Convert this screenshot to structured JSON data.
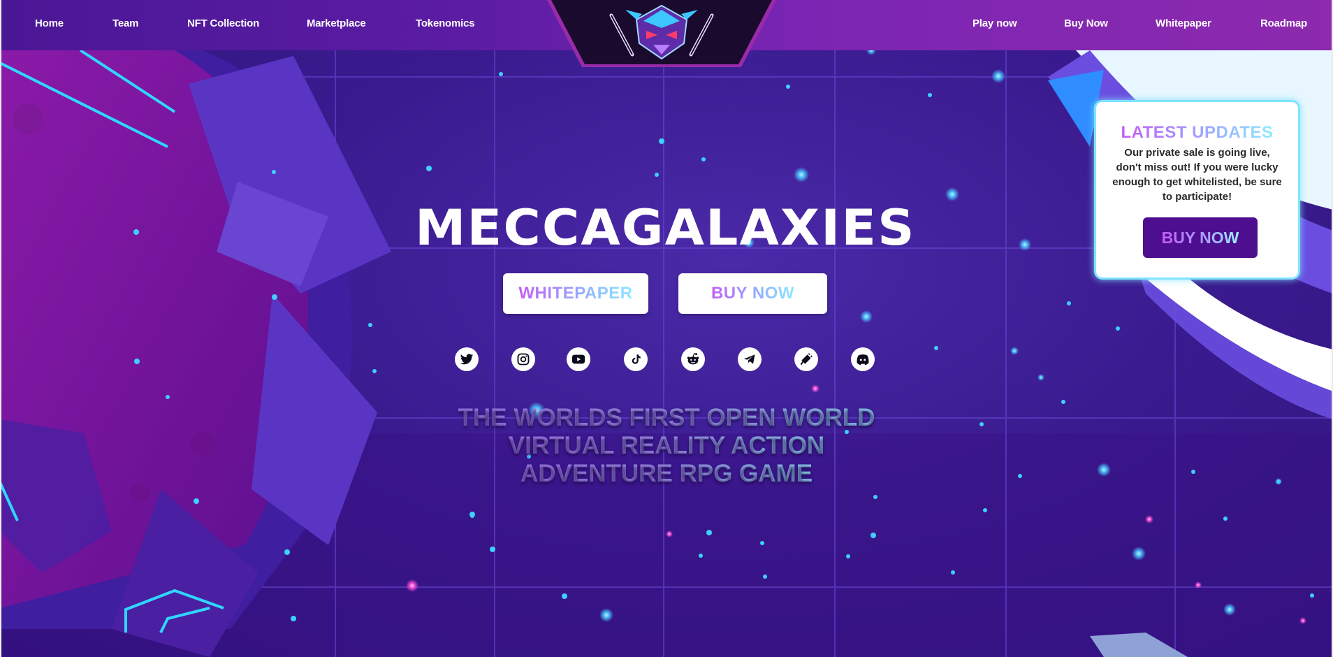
{
  "nav": {
    "left": [
      "Home",
      "Team",
      "NFT Collection",
      "Marketplace",
      "Tokenomics"
    ],
    "right": [
      "Play now",
      "Buy Now",
      "Whitepaper",
      "Roadmap"
    ]
  },
  "hero": {
    "title": "MECCAGALAXIES",
    "whitepaper_label": "WHITEPAPER",
    "buy_label": "BUY NOW",
    "tagline": [
      "THE WORLDS FIRST OPEN WORLD",
      "VIRTUAL REALITY ACTION",
      "ADVENTURE RPG GAME"
    ]
  },
  "social_icons": [
    "twitter-icon",
    "instagram-icon",
    "youtube-icon",
    "tiktok-icon",
    "reddit-icon",
    "telegram-icon",
    "megaphone-icon",
    "discord-icon"
  ],
  "updates": {
    "title": "LATEST UPDATES",
    "body": "Our private sale is going live, don't miss out! If you were lucky enough to get whitelisted, be sure to participate!",
    "button_label": "BUY NOW"
  },
  "colors": {
    "nav_start": "#4a1795",
    "nav_end": "#8d2aae",
    "background": "#3a1b8f",
    "updates_button": "#4d0f8f",
    "updates_border": "#7fe3ff"
  }
}
